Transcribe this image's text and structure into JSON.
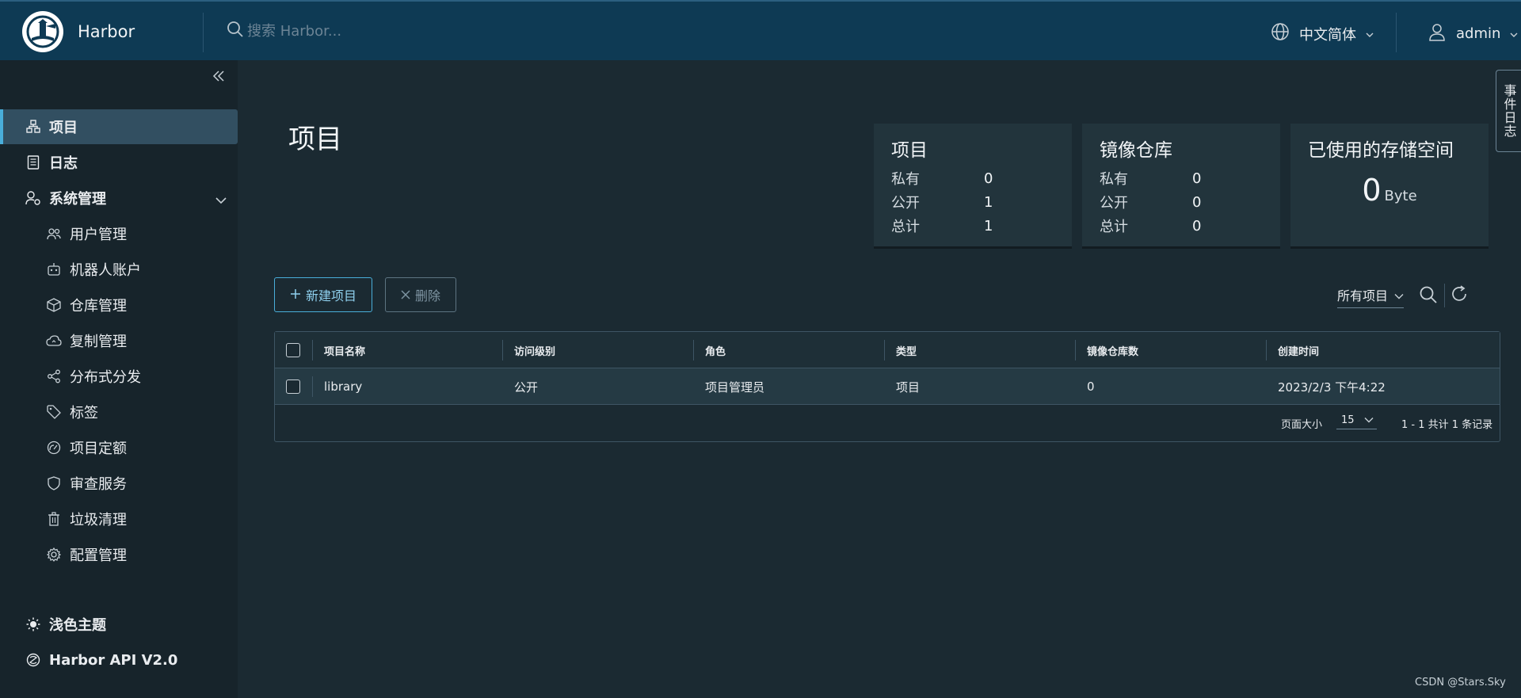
{
  "header": {
    "brand": "Harbor",
    "search_placeholder": "搜索 Harbor...",
    "language": "中文简体",
    "user": "admin"
  },
  "sidebar": {
    "items": [
      {
        "label": "项目",
        "icon": "projects-icon"
      },
      {
        "label": "日志",
        "icon": "logs-icon"
      },
      {
        "label": "系统管理",
        "icon": "admin-icon"
      }
    ],
    "admin_items": [
      {
        "label": "用户管理",
        "icon": "users-icon"
      },
      {
        "label": "机器人账户",
        "icon": "robot-icon"
      },
      {
        "label": "仓库管理",
        "icon": "registry-icon"
      },
      {
        "label": "复制管理",
        "icon": "replication-icon"
      },
      {
        "label": "分布式分发",
        "icon": "share-icon"
      },
      {
        "label": "标签",
        "icon": "tag-icon"
      },
      {
        "label": "项目定额",
        "icon": "quota-icon"
      },
      {
        "label": "审查服务",
        "icon": "shield-icon"
      },
      {
        "label": "垃圾清理",
        "icon": "trash-icon"
      },
      {
        "label": "配置管理",
        "icon": "gear-icon"
      }
    ],
    "bottom": {
      "theme": "浅色主题",
      "api": "Harbor API V2.0"
    }
  },
  "main": {
    "title": "项目",
    "cards": {
      "projects": {
        "title": "项目",
        "rows": [
          {
            "label": "私有",
            "value": "0"
          },
          {
            "label": "公开",
            "value": "1"
          },
          {
            "label": "总计",
            "value": "1"
          }
        ]
      },
      "repos": {
        "title": "镜像仓库",
        "rows": [
          {
            "label": "私有",
            "value": "0"
          },
          {
            "label": "公开",
            "value": "0"
          },
          {
            "label": "总计",
            "value": "0"
          }
        ]
      },
      "storage": {
        "title": "已使用的存储空间",
        "value": "0",
        "unit": "Byte"
      }
    },
    "toolbar": {
      "new_project": "新建项目",
      "delete": "删除",
      "filter": "所有项目"
    },
    "table": {
      "columns": [
        "项目名称",
        "访问级别",
        "角色",
        "类型",
        "镜像仓库数",
        "创建时间"
      ],
      "rows": [
        {
          "name": "library",
          "access": "公开",
          "role": "项目管理员",
          "type": "项目",
          "repo_count": "0",
          "created": "2023/2/3 下午4:22"
        }
      ],
      "page_size_label": "页面大小",
      "page_size": "15",
      "total": "1 - 1 共计 1 条记录"
    }
  },
  "events_tab": "事件日志",
  "watermark": "CSDN @Stars.Sky",
  "colors": {
    "header_bg": "#0e3a54",
    "sidebar_bg": "#17242b",
    "main_bg": "#1b2a32",
    "card_bg": "#22343c",
    "accent": "#49aeda"
  }
}
